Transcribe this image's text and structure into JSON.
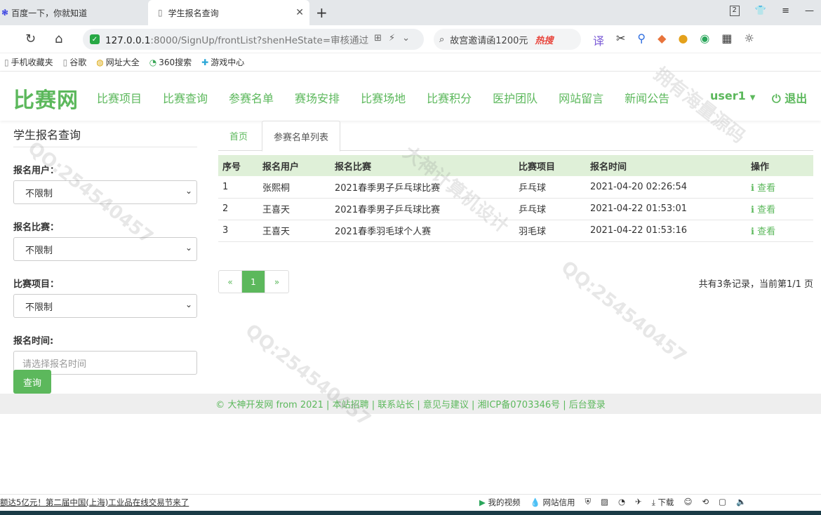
{
  "browser": {
    "tabs": [
      {
        "title": "百度一下，你就知道"
      },
      {
        "title": "学生报名查询"
      }
    ],
    "url_main": "127.0.0.1",
    "url_rest": ":8000/SignUp/frontList?shenHeState=审核通过",
    "search_text": "故宫邀请函1200元",
    "search_hot": "热搜",
    "bookmarks": [
      "手机收藏夹",
      "谷歌",
      "网址大全",
      "360搜索",
      "游戏中心"
    ],
    "page_count_badge": "2"
  },
  "site": {
    "logo": "比赛网",
    "nav": [
      "比赛项目",
      "比赛查询",
      "参赛名单",
      "赛场安排",
      "比赛场地",
      "比赛积分",
      "医护团队",
      "网站留言",
      "新闻公告"
    ],
    "user": "user1",
    "logout": "退出"
  },
  "sidebar": {
    "title": "学生报名查询",
    "fields": [
      {
        "label": "报名用户：",
        "value": "不限制"
      },
      {
        "label": "报名比赛：",
        "value": "不限制"
      },
      {
        "label": "比赛项目：",
        "value": "不限制"
      }
    ],
    "time_label": "报名时间:",
    "time_placeholder": "请选择报名时间",
    "query_button": "查询"
  },
  "main": {
    "tabs": [
      "首页",
      "参赛名单列表"
    ],
    "columns": [
      "序号",
      "报名用户",
      "报名比赛",
      "比赛项目",
      "报名时间",
      "操作"
    ],
    "rows": [
      {
        "no": "1",
        "user": "张熙桐",
        "match": "2021春季男子乒乓球比赛",
        "item": "乒乓球",
        "time": "2021-04-20 02:26:54",
        "action": "查看"
      },
      {
        "no": "2",
        "user": "王喜天",
        "match": "2021春季男子乒乓球比赛",
        "item": "乒乓球",
        "time": "2021-04-22 01:53:01",
        "action": "查看"
      },
      {
        "no": "3",
        "user": "王喜天",
        "match": "2021春季羽毛球个人赛",
        "item": "羽毛球",
        "time": "2021-04-22 01:53:16",
        "action": "查看"
      }
    ],
    "pager": {
      "prev": "«",
      "current": "1",
      "next": "»"
    },
    "page_info": "共有3条记录，当前第1/1 页"
  },
  "footer": "© 大神开发网 from 2021 | 本站招聘 | 联系站长 | 意见与建议 | 湘ICP备0703346号 | 后台登录",
  "status": {
    "news": "额达5亿元！第二届中国(上海)工业品在线交易节来了",
    "items": [
      "我的视频",
      "网站信用",
      "下载"
    ]
  },
  "colors": {
    "accent": "#5cb85c",
    "table_header": "#dff0d8"
  }
}
